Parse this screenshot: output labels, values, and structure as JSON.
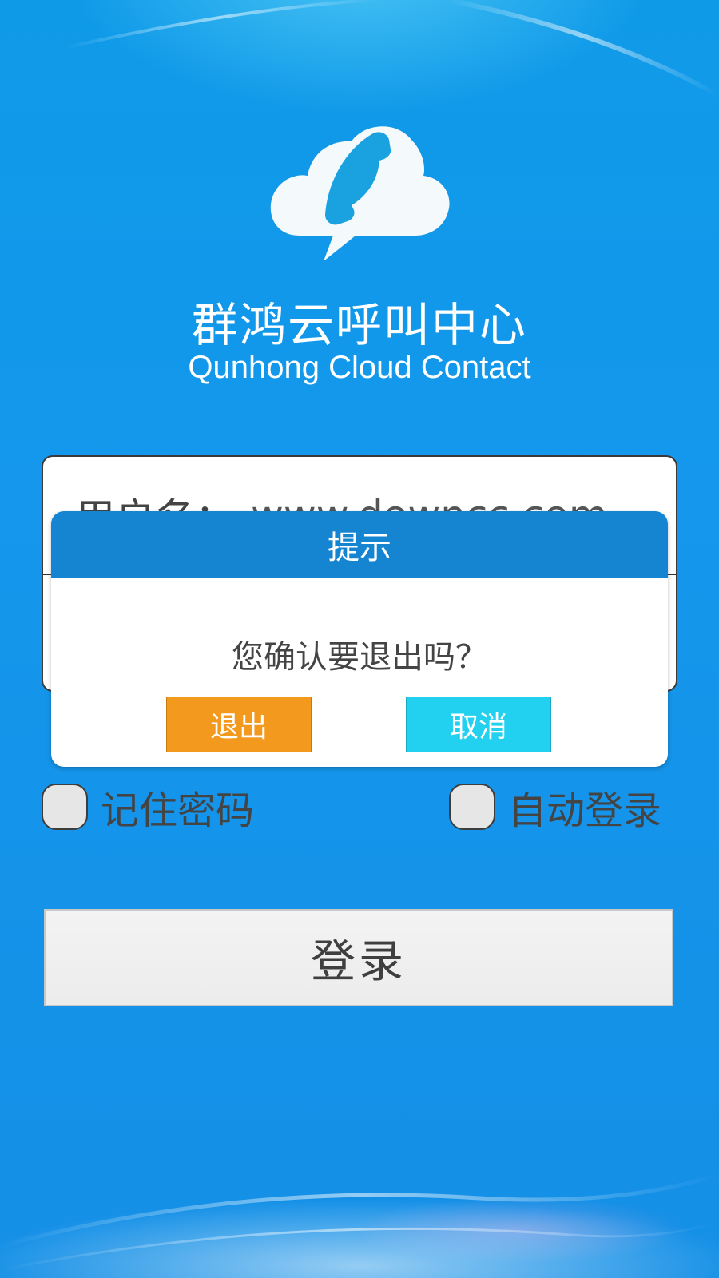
{
  "app": {
    "title": "群鸿云呼叫中心",
    "subtitle": "Qunhong Cloud Contact",
    "logo_icon": "cloud-phone-icon"
  },
  "form": {
    "username_label": "用户名：",
    "username_value": "www.downcc.com",
    "password_label": "",
    "password_value": ""
  },
  "options": {
    "remember_password": {
      "label": "记住密码",
      "checked": false
    },
    "auto_login": {
      "label": "自动登录",
      "checked": false
    }
  },
  "login_button": {
    "label": "登录"
  },
  "dialog": {
    "title": "提示",
    "message": "您确认要退出吗？",
    "confirm_label": "退出",
    "cancel_label": "取消"
  },
  "colors": {
    "background": "#1497ec",
    "dialog_header": "#1585d2",
    "exit_button": "#f39a1e",
    "cancel_button": "#22d0f0"
  }
}
